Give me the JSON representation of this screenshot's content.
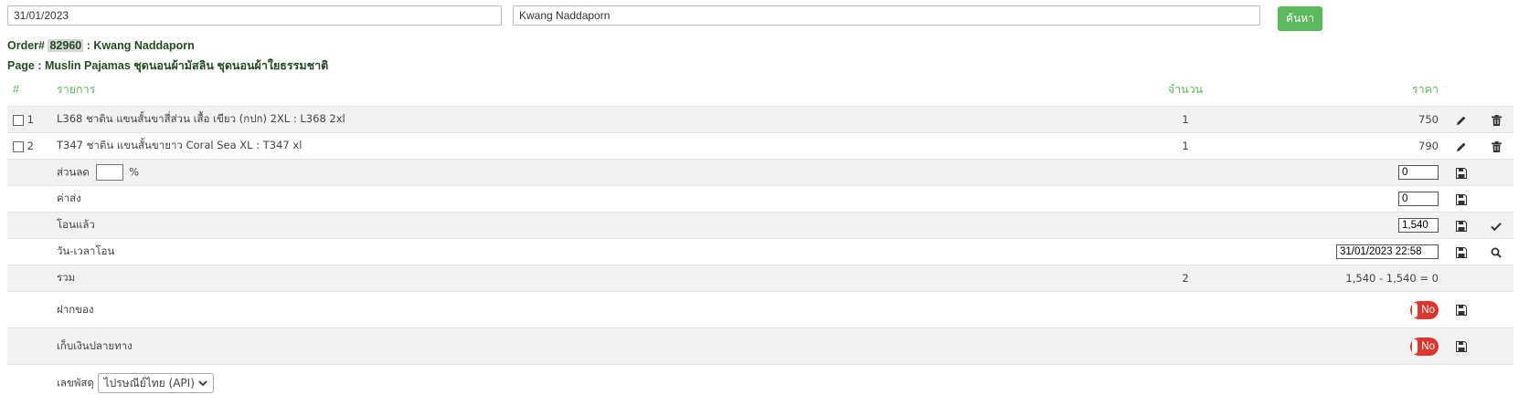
{
  "search": {
    "date_value": "31/01/2023",
    "name_value": "Kwang Naddaporn",
    "button_label": "ค้นหา"
  },
  "order": {
    "label": "Order#",
    "number": "82960",
    "separator": ":",
    "customer": "Kwang Naddaporn",
    "page_line": "Page : Muslin Pajamas ชุดนอนผ้ามัสลิน ชุดนอนผ้าใยธรรมชาติ"
  },
  "table": {
    "headers": {
      "num": "#",
      "item": "รายการ",
      "qty": "จำนวน",
      "price": "ราคา"
    },
    "rows": [
      {
        "num": "1",
        "item": "L368 ชาติน แขนสั้นขาสี่ส่วน เสื้อ เขียว (กปก) 2XL : L368 2xl",
        "qty": "1",
        "price": "750"
      },
      {
        "num": "2",
        "item": "T347 ชาติน แขนสั้นขายาว Coral Sea XL : T347 xl",
        "qty": "1",
        "price": "790"
      }
    ],
    "discount": {
      "label": "ส่วนลด",
      "unit": "%",
      "value": "0"
    },
    "shipping": {
      "label": "ค่าส่ง",
      "value": "0"
    },
    "transferred": {
      "label": "โอนแล้ว",
      "value": "1,540"
    },
    "transfer_time": {
      "label": "วัน-เวลาโอน",
      "value": "31/01/2023 22:58"
    },
    "total": {
      "label": "รวม",
      "qty": "2",
      "summary": "1,540 - 1,540 = 0"
    },
    "deposit": {
      "label": "ฝากของ",
      "toggle": "No"
    },
    "cod": {
      "label": "เก็บเงินปลายทาง",
      "toggle": "No"
    },
    "tracking": {
      "label": "เลขพัสดุ",
      "carrier": "ไปรษณีย์ไทย (API)"
    }
  },
  "colors": {
    "accent_green": "#5cb85c",
    "toggle_red": "#d9372f",
    "heading_green": "#234d20"
  }
}
